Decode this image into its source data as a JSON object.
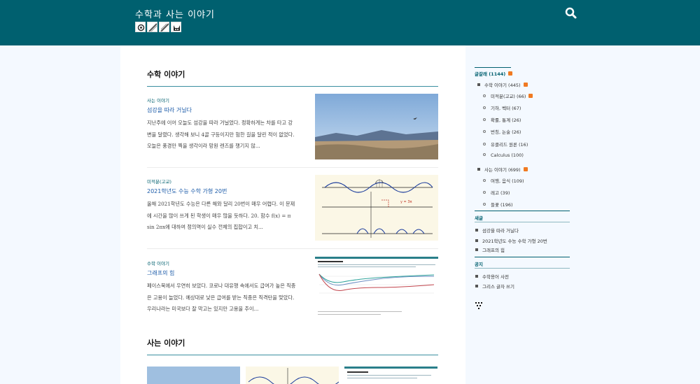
{
  "header": {
    "site_title": "수학과 사는 이야기",
    "icons": [
      "gear-icon",
      "pencil-icon",
      "pencil-icon",
      "cat-icon"
    ]
  },
  "colors": {
    "header_bg": "#00606f",
    "accent": "#00606f",
    "link": "#1a5aa8",
    "rss": "#f07a22"
  },
  "sections": [
    {
      "title": "수학 이야기",
      "posts": [
        {
          "category": "사는 이야기",
          "title": "섬강을 따라 거닐다",
          "excerpt": "지난주에 이어 오늘도 섬강을 따라 거닐었다. 정확하게는 차를 타고 강변을 달렸다. 생각해 보니 4골 구등이지만 험한 길을 달린 적이 없었다. 오늘은 풍경만 찍을 생각이라 망원 렌즈를 챙기지 않...",
          "thumb": "landscape-photo"
        },
        {
          "category": "미적분(고교)",
          "title": "2021학년도 수능 수학 가형 20번",
          "excerpt": "올해 2021학년도 수능은 다른 해와 달리 20번이 매우 어렵다. 이 문제에 시간을 많이 쓰게 된 학생이 매우 많을 듯하다. 20. 함수 f(x) = π sin 2πx에 대하여 정의역이 실수 전체의 집합이고 치...",
          "thumb": "graph-sketch"
        },
        {
          "category": "수학 이야기",
          "title": "그래프의 힘",
          "excerpt": "페이스북에서 우연히 보았다. 코로나 대유행 속에서도 급여가 높은 직종은 고용이 늘었다. 예상대로 낮은 급여를 받는 직종은 직격탄을 맞았다. 우리나라는 미국보다 잘 막고는 있지만 고용을 추이...",
          "thumb": "line-chart"
        }
      ]
    },
    {
      "title": "사는 이야기"
    }
  ],
  "sidebar": {
    "categories": {
      "heading": "글갈래 (1144)",
      "items": [
        {
          "label": "수학 이야기 (445)",
          "level": 1,
          "rss": true
        },
        {
          "label": "미적분(고교) (66)",
          "level": 2,
          "rss": true
        },
        {
          "label": "기하, 벡터 (67)",
          "level": 2,
          "rss": false
        },
        {
          "label": "확률, 통계 (26)",
          "level": 2,
          "rss": false
        },
        {
          "label": "번칭, 논술 (26)",
          "level": 2,
          "rss": false
        },
        {
          "label": "유클리드 원론 (16)",
          "level": 2,
          "rss": false
        },
        {
          "label": "Calculus (100)",
          "level": 2,
          "rss": false
        },
        {
          "label": "사는 이야기 (699)",
          "level": 1,
          "rss": true
        },
        {
          "label": "여행, 음식 (109)",
          "level": 2,
          "rss": false
        },
        {
          "label": "레고 (39)",
          "level": 2,
          "rss": false
        },
        {
          "label": "들꽃 (196)",
          "level": 2,
          "rss": false
        }
      ]
    },
    "recent": {
      "heading": "새글",
      "items": [
        "섬강을 따라 거닐다",
        "2021학년도 수능 수학 가형 20번",
        "그래프의 힘"
      ]
    },
    "notice": {
      "heading": "공지",
      "items": [
        "수학용어 사전",
        "그리스 글자 쓰기"
      ]
    }
  }
}
